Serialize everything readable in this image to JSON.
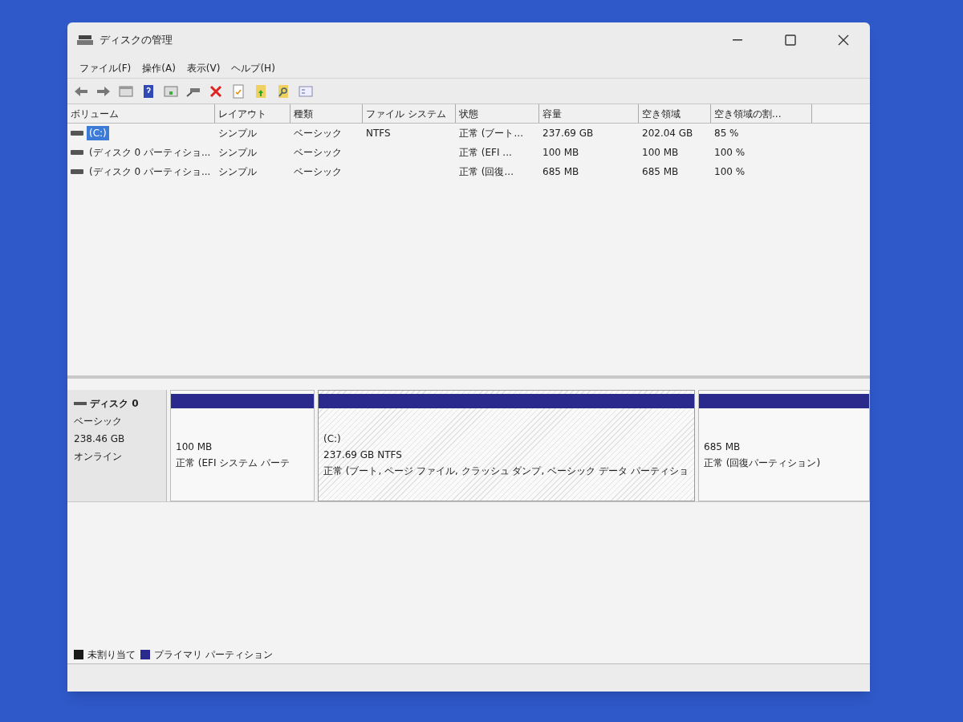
{
  "window": {
    "title": "ディスクの管理"
  },
  "menu": [
    {
      "label": "ファイル(F)"
    },
    {
      "label": "操作(A)"
    },
    {
      "label": "表示(V)"
    },
    {
      "label": "ヘルプ(H)"
    }
  ],
  "table": {
    "columns": [
      "ボリューム",
      "レイアウト",
      "種類",
      "ファイル システム",
      "状態",
      "容量",
      "空き領域",
      "空き領域の割..."
    ],
    "rows": [
      {
        "selected": true,
        "cells": [
          "(C:)",
          "シンプル",
          "ベーシック",
          "NTFS",
          "正常 (ブート...",
          "237.69 GB",
          "202.04 GB",
          "85 %"
        ]
      },
      {
        "selected": false,
        "cells": [
          "(ディスク 0 パーティショ...",
          "シンプル",
          "ベーシック",
          "",
          "正常 (EFI ...",
          "100 MB",
          "100 MB",
          "100 %"
        ]
      },
      {
        "selected": false,
        "cells": [
          "(ディスク 0 パーティショ...",
          "シンプル",
          "ベーシック",
          "",
          "正常 (回復...",
          "685 MB",
          "685 MB",
          "100 %"
        ]
      }
    ]
  },
  "disk": {
    "name": "ディスク 0",
    "type": "ベーシック",
    "size": "238.46 GB",
    "status": "オンライン",
    "partitions": [
      {
        "selected": false,
        "size": "100 MB",
        "status": "正常 (EFI システム パーテ"
      },
      {
        "selected": true,
        "name": "(C:)",
        "size": "237.69 GB NTFS",
        "status": "正常 (ブート, ページ ファイル, クラッシュ ダンプ, ベーシック データ パーティショ"
      },
      {
        "selected": false,
        "size": "685 MB",
        "status": "正常 (回復パーティション)"
      }
    ]
  },
  "legend": [
    {
      "label": "未割り当て",
      "color": "#1a1a1a"
    },
    {
      "label": "プライマリ パーティション",
      "color": "#2a2a8c"
    }
  ]
}
